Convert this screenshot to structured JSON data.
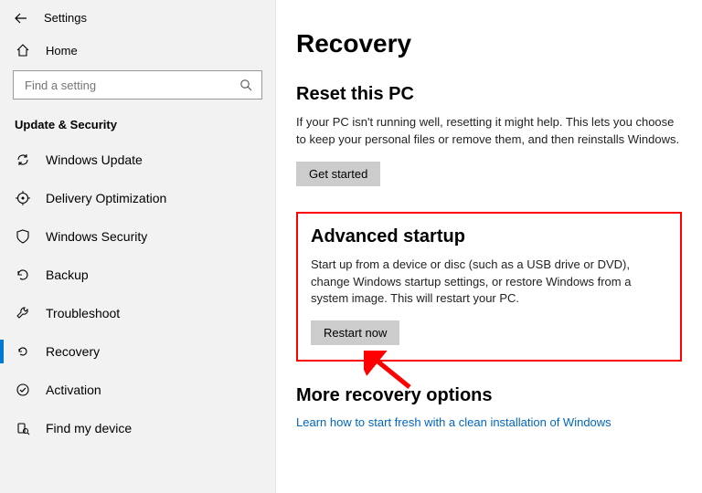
{
  "window_title": "Settings",
  "sidebar": {
    "home_label": "Home",
    "search_placeholder": "Find a setting",
    "section_label": "Update & Security",
    "items": [
      {
        "label": "Windows Update"
      },
      {
        "label": "Delivery Optimization"
      },
      {
        "label": "Windows Security"
      },
      {
        "label": "Backup"
      },
      {
        "label": "Troubleshoot"
      },
      {
        "label": "Recovery"
      },
      {
        "label": "Activation"
      },
      {
        "label": "Find my device"
      }
    ]
  },
  "main": {
    "page_title": "Recovery",
    "reset": {
      "title": "Reset this PC",
      "body": "If your PC isn't running well, resetting it might help. This lets you choose to keep your personal files or remove them, and then reinstalls Windows.",
      "button": "Get started"
    },
    "advanced": {
      "title": "Advanced startup",
      "body": "Start up from a device or disc (such as a USB drive or DVD), change Windows startup settings, or restore Windows from a system image. This will restart your PC.",
      "button": "Restart now"
    },
    "more": {
      "title": "More recovery options",
      "link": "Learn how to start fresh with a clean installation of Windows"
    }
  }
}
